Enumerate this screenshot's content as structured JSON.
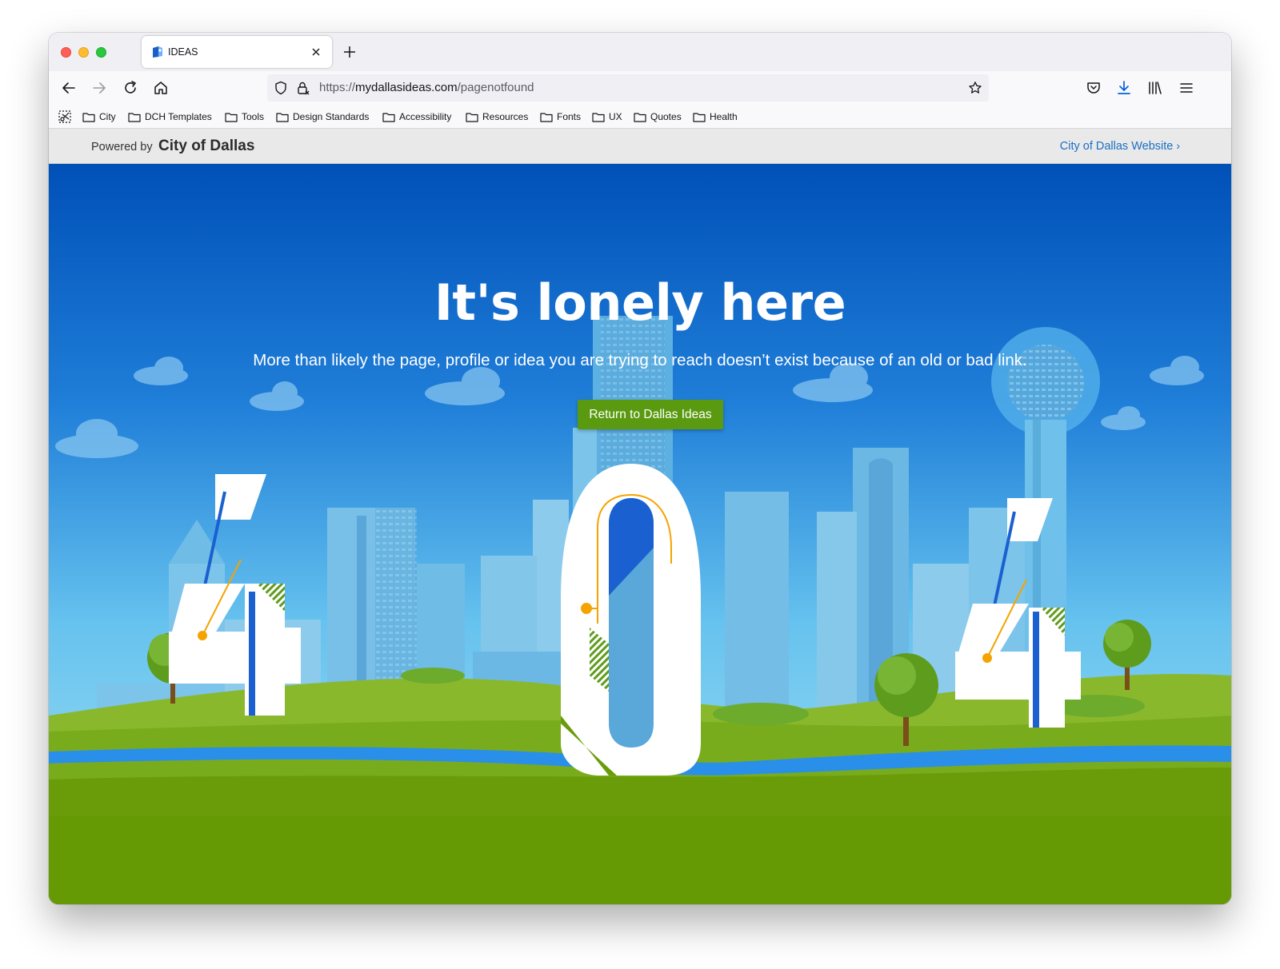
{
  "browser": {
    "tab": {
      "title": "IDEAS"
    },
    "url": {
      "scheme": "https://",
      "host": "mydallasideas.com",
      "path": "/pagenotfound"
    },
    "bookmarks": [
      {
        "label": "City"
      },
      {
        "label": "DCH Templates"
      },
      {
        "label": "Tools"
      },
      {
        "label": "Design Standards"
      },
      {
        "label": "Accessibility"
      },
      {
        "label": "Resources"
      },
      {
        "label": "Fonts"
      },
      {
        "label": "UX"
      },
      {
        "label": "Quotes"
      },
      {
        "label": "Health"
      }
    ],
    "icons": {
      "back": "arrow-left-icon",
      "forward": "arrow-right-icon",
      "reload": "reload-icon",
      "home": "home-icon",
      "shield": "shield-icon",
      "lock": "lock-icon",
      "bookmark_star": "star-icon",
      "pocket": "pocket-icon",
      "downloads": "download-icon",
      "library": "library-icon",
      "menu": "hamburger-menu-icon"
    }
  },
  "site": {
    "powered_by_prefix": "Powered by",
    "powered_by_brand": "City of Dallas",
    "city_link": "City of Dallas Website",
    "city_link_chevron": "›"
  },
  "hero": {
    "title": "It's lonely here",
    "subtitle": "More than likely the page, profile or idea you are trying to reach doesn’t exist because of an old or bad link.",
    "button": "Return to Dallas Ideas"
  },
  "colors": {
    "sky_top": "#0050b8",
    "sky_bottom": "#8fdcf3",
    "grass": "#6a9c0a",
    "river": "#2a8fe8",
    "button": "#5a9a10",
    "link": "#1a6fc4",
    "accent_orange": "#f5a300"
  }
}
